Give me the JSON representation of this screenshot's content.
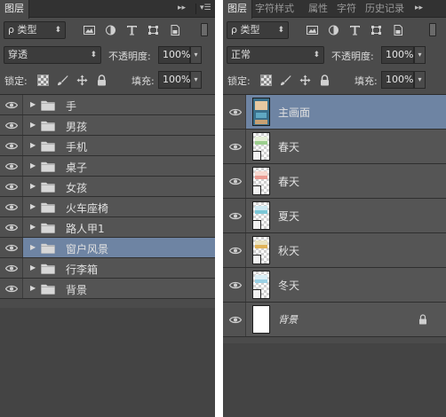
{
  "left_panel": {
    "tab_label": "图层",
    "tab_menu_icon": "double-chevron-icon",
    "panel_menu_icon": "panel-menu-icon",
    "filter": {
      "label": "ρ 类型"
    },
    "filter_icons": [
      "image-filter-icon",
      "adjustment-filter-icon",
      "type-filter-icon",
      "shape-filter-icon",
      "smart-object-filter-icon"
    ],
    "blend_mode": "穿透",
    "opacity_label": "不透明度:",
    "opacity_value": "100%",
    "lock_label": "锁定:",
    "lock_icons": [
      "lock-transparent-icon",
      "lock-paint-icon",
      "lock-position-icon",
      "lock-all-icon"
    ],
    "fill_label": "填充:",
    "fill_value": "100%",
    "layers": [
      {
        "name": "手",
        "selected": false
      },
      {
        "name": "男孩",
        "selected": false
      },
      {
        "name": "手机",
        "selected": false
      },
      {
        "name": "桌子",
        "selected": false
      },
      {
        "name": "女孩",
        "selected": false
      },
      {
        "name": "火车座椅",
        "selected": false
      },
      {
        "name": "路人甲1",
        "selected": false
      },
      {
        "name": "窗户风景",
        "selected": true
      },
      {
        "name": "行李箱",
        "selected": false
      },
      {
        "name": "背景",
        "selected": false
      }
    ]
  },
  "right_panel": {
    "tabs": [
      "图层",
      "字符样式",
      "属性",
      "字符",
      "历史记录"
    ],
    "filter": {
      "label": "ρ 类型"
    },
    "blend_mode": "正常",
    "opacity_label": "不透明度:",
    "opacity_value": "100%",
    "lock_label": "锁定:",
    "fill_label": "填充:",
    "fill_value": "100%",
    "layers": [
      {
        "name": "主画面",
        "selected": true,
        "thumb": "main"
      },
      {
        "name": "春天",
        "selected": false,
        "thumb": "spring1"
      },
      {
        "name": "春天",
        "selected": false,
        "thumb": "spring2"
      },
      {
        "name": "夏天",
        "selected": false,
        "thumb": "summer"
      },
      {
        "name": "秋天",
        "selected": false,
        "thumb": "autumn"
      },
      {
        "name": "冬天",
        "selected": false,
        "thumb": "winter"
      },
      {
        "name": "背景",
        "selected": false,
        "thumb": "white",
        "locked": true
      }
    ]
  },
  "colors": {
    "panel_bg": "#4b4b4b",
    "selected_row": "#6e84a3",
    "tab_bar": "#323232"
  }
}
